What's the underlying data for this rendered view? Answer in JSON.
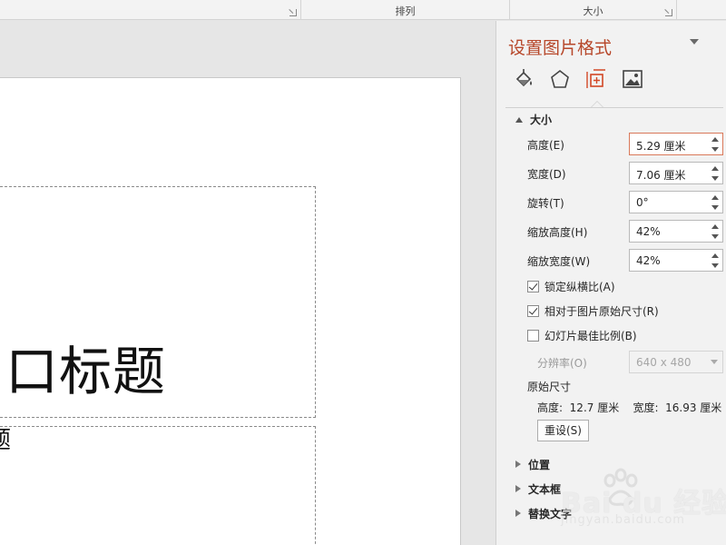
{
  "ribbon": {
    "groups": [
      {
        "label": ""
      },
      {
        "label": "排列"
      },
      {
        "label": "大小"
      }
    ]
  },
  "slide": {
    "title_text": "口标题",
    "subtitle_text": "题"
  },
  "pane": {
    "title": "设置图片格式",
    "tabs": [
      {
        "icon": "fill-line-icon"
      },
      {
        "icon": "effects-pentagon-icon"
      },
      {
        "icon": "size-properties-icon",
        "active": true
      },
      {
        "icon": "picture-icon"
      }
    ],
    "size_section": {
      "header": "大小",
      "fields": [
        {
          "label": "高度(E)",
          "value": "5.29 厘米"
        },
        {
          "label": "宽度(D)",
          "value": "7.06 厘米"
        },
        {
          "label": "旋转(T)",
          "value": "0°"
        },
        {
          "label": "缩放高度(H)",
          "value": "42%"
        },
        {
          "label": "缩放宽度(W)",
          "value": "42%"
        }
      ],
      "checks": [
        {
          "label": "锁定纵横比(A)",
          "checked": true
        },
        {
          "label": "相对于图片原始尺寸(R)",
          "checked": true
        },
        {
          "label": "幻灯片最佳比例(B)",
          "checked": false
        }
      ],
      "resolution": {
        "label": "分辨率(O)",
        "value": "640 x 480"
      },
      "original_size": {
        "header": "原始尺寸",
        "text": "高度:  12.7 厘米    宽度:  16.93 厘米"
      },
      "reset_label": "重设(S)"
    },
    "collapsed_sections": [
      {
        "label": "位置"
      },
      {
        "label": "文本框"
      },
      {
        "label": "替换文字"
      }
    ]
  },
  "watermark": {
    "brand": "Bai du 经验",
    "url": "jingyan.baidu.com"
  },
  "colors": {
    "accent": "#b7472a",
    "pane_bg": "#f2f2f2",
    "workspace_bg": "#e6e6e6"
  }
}
